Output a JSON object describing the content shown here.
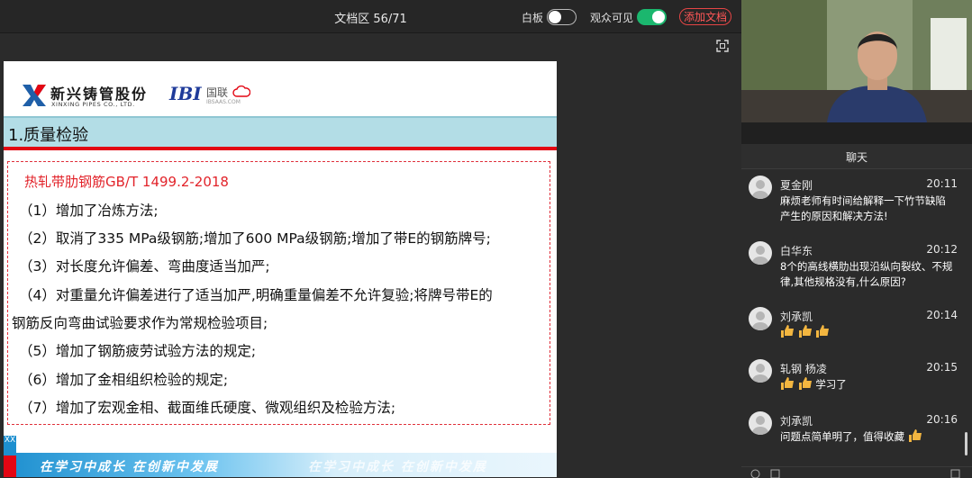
{
  "topbar": {
    "doc_title": "文档区 56/71",
    "whiteboard_label": "白板",
    "whiteboard_on": false,
    "audience_visible_label": "观众可见",
    "audience_visible_on": true,
    "add_doc_label": "添加文档",
    "accent_green": "#1bb76e",
    "accent_red": "#e54545"
  },
  "slide": {
    "logo1_cn": "新兴铸管股份",
    "logo1_en": "XINXING PIPES CO., LTD.",
    "logo2_mark": "IBI",
    "logo2_cn": "国联",
    "logo2_en": "IBSAAS.COM",
    "title": "1.质量检验",
    "content_heading": "热轧带肋钢筋GB/T 1499.2-2018",
    "lines": [
      "（1）增加了冶炼方法;",
      "（2）取消了335 MPa级钢筋;增加了600 MPa级钢筋;增加了带E的钢筋牌号;",
      "（3）对长度允许偏差、弯曲度适当加严;",
      "（4）对重量允许偏差进行了适当加严,明确重量偏差不允许复验;将牌号带E的",
      "钢筋反向弯曲试验要求作为常规检验项目;",
      "（5）增加了钢筋疲劳试验方法的规定;",
      "（6）增加了金相组织检验的规定;",
      "（7）增加了宏观金相、截面维氏硬度、微观组织及检验方法;"
    ],
    "footer_tag": "XX",
    "footer_slogan": "在学习中成长  在创新中发展",
    "footer_slogan_ghost": "在学习中成长  在创新中发展",
    "title_band_color": "#b3dde6",
    "accent_red": "#e30613"
  },
  "chat": {
    "title": "聊天",
    "messages": [
      {
        "name": "夏金刚",
        "time": "20:11",
        "text": "麻烦老师有时间给解释一下竹节缺陷产生的原因和解决方法!",
        "thumbs": 0
      },
      {
        "name": "白华东",
        "time": "20:12",
        "text": "8个的高线横肋出现沿纵向裂纹、不规律,其他规格没有,什么原因?",
        "thumbs": 0
      },
      {
        "name": "刘承凯",
        "time": "20:14",
        "text": "",
        "thumbs": 3
      },
      {
        "name": "轧钢 杨凌",
        "time": "20:15",
        "text": "学习了",
        "thumbs": 2
      },
      {
        "name": "刘承凯",
        "time": "20:16",
        "text": "问题点简单明了，值得收藏",
        "thumbs_after": 1
      }
    ]
  }
}
